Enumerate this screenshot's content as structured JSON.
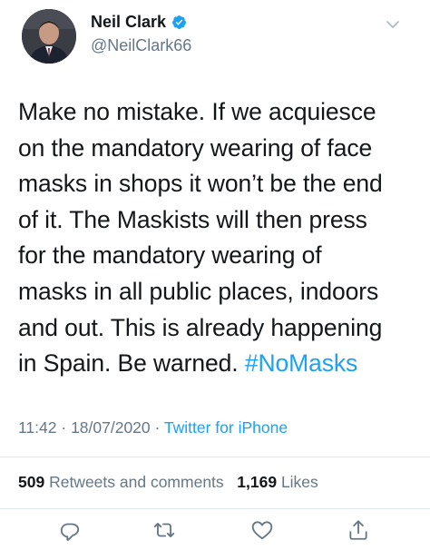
{
  "author": {
    "name": "Neil Clark",
    "handle": "@NeilClark66",
    "verified": true
  },
  "tweet": {
    "lines": [
      "Make no mistake. If we acquiesce",
      "on the mandatory wearing of face",
      "masks in shops it won’t be the end",
      "of it. The Maskists will then press",
      "for the mandatory wearing of",
      "masks in all public places, indoors",
      "and out. This is already happening"
    ],
    "last_line_text": "in Spain. Be warned. ",
    "hashtag": "#NoMasks"
  },
  "meta": {
    "time": "11:42",
    "sep1": " · ",
    "date": "18/07/2020",
    "sep2": " · ",
    "source": "Twitter for iPhone"
  },
  "stats": {
    "retweets_count": "509",
    "retweets_label": "Retweets and comments",
    "likes_count": "1,169",
    "likes_label": "Likes"
  },
  "actions": {
    "reply_icon": "reply-icon",
    "retweet_icon": "retweet-icon",
    "like_icon": "heart-icon",
    "share_icon": "share-icon"
  },
  "colors": {
    "link": "#1da1f2",
    "secondary_text": "#657786",
    "primary_text": "#14171a",
    "divider": "#e1e8ed"
  }
}
